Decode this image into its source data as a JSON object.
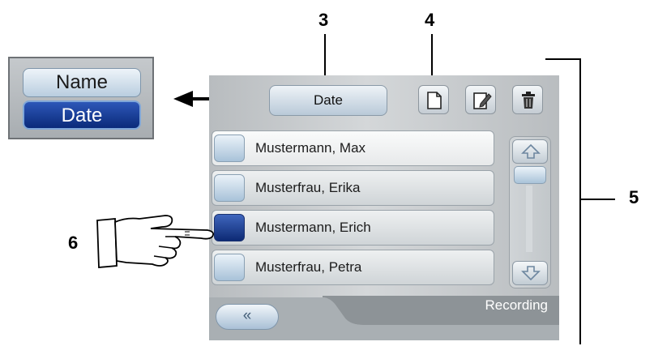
{
  "callouts": {
    "c3": "3",
    "c4": "4",
    "c5": "5",
    "c6": "6"
  },
  "sort_menu": {
    "name_label": "Name",
    "date_label": "Date",
    "selected": "Date"
  },
  "toolbar": {
    "sort_label": "Date",
    "new_icon": "new-document-icon",
    "edit_icon": "edit-icon",
    "delete_icon": "trash-icon"
  },
  "patients": [
    {
      "name": "Mustermann, Max",
      "selected": false
    },
    {
      "name": "Musterfrau, Erika",
      "selected": false
    },
    {
      "name": "Mustermann, Erich",
      "selected": true
    },
    {
      "name": "Musterfrau, Petra",
      "selected": false
    }
  ],
  "scrollbar": {
    "up_icon": "arrow-up-icon",
    "down_icon": "arrow-down-icon"
  },
  "footer": {
    "back_label": "«",
    "mode_label": "Recording"
  },
  "colors": {
    "selected_blue": "#0d2a74",
    "unselected_blue": "#a8c2d9",
    "panel_gray": "#c2c7ca"
  }
}
